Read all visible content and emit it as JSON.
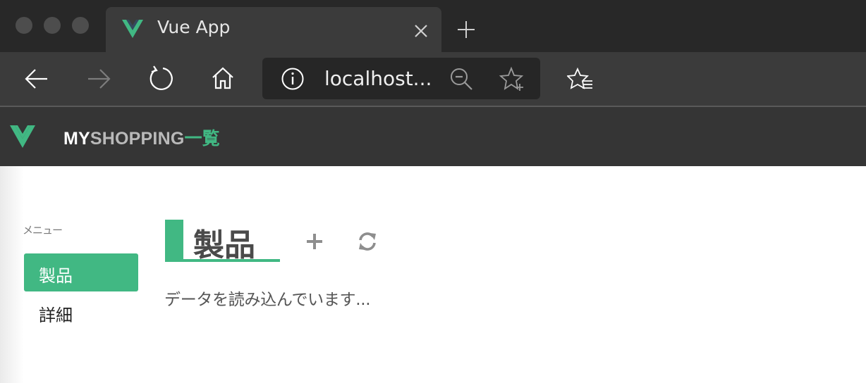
{
  "browser": {
    "tab": {
      "title": "Vue App",
      "close_icon": "close-icon"
    },
    "new_tab_icon": "plus-icon",
    "address": {
      "url": "localhost..."
    },
    "icons": [
      "back-icon",
      "forward-icon",
      "refresh-icon",
      "home-icon",
      "info-icon",
      "zoom-out-icon",
      "add-favorite-icon",
      "favorites-icon"
    ]
  },
  "app": {
    "brand": {
      "my": "MY",
      "shopping": "SHOPPING",
      "list": "一覧"
    },
    "colors": {
      "accent": "#41b883",
      "header_bg": "#353535"
    }
  },
  "sidebar": {
    "caption": "メニュー",
    "items": [
      {
        "label": "製品",
        "active": true
      },
      {
        "label": "詳細",
        "active": false
      }
    ]
  },
  "main": {
    "title": "製品",
    "add_icon": "plus-icon",
    "refresh_icon": "refresh-icon",
    "status": "データを読み込んでいます..."
  }
}
